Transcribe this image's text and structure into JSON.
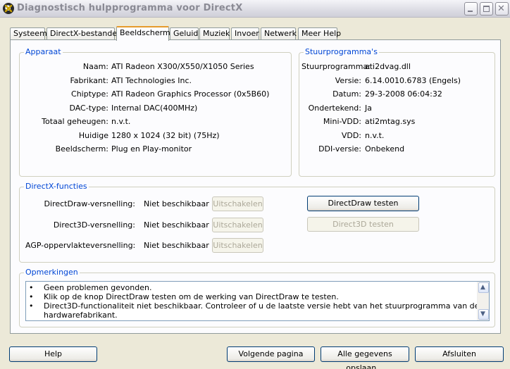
{
  "window": {
    "title": "Diagnostisch hulpprogramma voor DirectX",
    "icon": "directx-x-icon",
    "min_icon": "minimize-icon",
    "max_icon": "maximize-icon",
    "close_icon": "close-icon",
    "close_glyph": "✕"
  },
  "tabs": [
    {
      "label": "Systeem"
    },
    {
      "label": "DirectX-bestanden"
    },
    {
      "label": "Beeldscherm",
      "active": true
    },
    {
      "label": "Geluid"
    },
    {
      "label": "Muziek"
    },
    {
      "label": "Invoer"
    },
    {
      "label": "Netwerk"
    },
    {
      "label": "Meer Help"
    }
  ],
  "device": {
    "legend": "Apparaat",
    "rows": [
      {
        "label": "Naam:",
        "value": "ATI Radeon X300/X550/X1050 Series"
      },
      {
        "label": "Fabrikant:",
        "value": "ATI Technologies Inc."
      },
      {
        "label": "Chiptype:",
        "value": "ATI Radeon Graphics Processor (0x5B60)"
      },
      {
        "label": "DAC-type:",
        "value": "Internal DAC(400MHz)"
      },
      {
        "label": "Totaal geheugen:",
        "value": "n.v.t."
      },
      {
        "label": "Huidige",
        "value": "1280 x 1024 (32 bit) (75Hz)"
      },
      {
        "label": "Beeldscherm:",
        "value": "Plug en Play-monitor"
      }
    ]
  },
  "driver": {
    "legend": "Stuurprogramma's",
    "rows": [
      {
        "label": "Stuurprogramma:",
        "value": "ati2dvag.dll"
      },
      {
        "label": "Versie:",
        "value": "6.14.0010.6783 (Engels)"
      },
      {
        "label": "Datum:",
        "value": "29-3-2008 06:04:32"
      },
      {
        "label": "Ondertekend:",
        "value": "Ja"
      },
      {
        "label": "Mini-VDD:",
        "value": "ati2mtag.sys"
      },
      {
        "label": "VDD:",
        "value": "n.v.t."
      },
      {
        "label": "DDI-versie:",
        "value": "Onbekend"
      }
    ]
  },
  "features": {
    "legend": "DirectX-functies",
    "rows": [
      {
        "label": "DirectDraw-versnelling:",
        "value": "Niet beschikbaar",
        "button": "Uitschakelen"
      },
      {
        "label": "Direct3D-versnelling:",
        "value": "Niet beschikbaar",
        "button": "Uitschakelen"
      },
      {
        "label": "AGP-oppervlakteversnelling:",
        "value": "Niet beschikbaar",
        "button": "Uitschakelen"
      }
    ],
    "test_directdraw": "DirectDraw testen",
    "test_direct3d": "Direct3D testen"
  },
  "notes": {
    "legend": "Opmerkingen",
    "bullet": "•",
    "lines": [
      "Geen problemen gevonden.",
      "Klik op de knop DirectDraw testen om de werking van DirectDraw te testen.",
      "Direct3D-functionaliteit niet beschikbaar. Controleer of u de laatste versie hebt van het stuurprogramma van de",
      "hardwarefabrikant."
    ],
    "scroll_up_glyph": "▲",
    "scroll_down_glyph": "▼"
  },
  "footer": {
    "help": "Help",
    "next_page": "Volgende pagina",
    "save_all": "Alle gegevens opslaan...",
    "close": "Afsluiten"
  },
  "colors": {
    "legend_blue": "#0046d5",
    "tab_accent": "#e69b2c",
    "dialog_bg": "#ece9d8",
    "panel_bg": "#fcfcfe"
  }
}
